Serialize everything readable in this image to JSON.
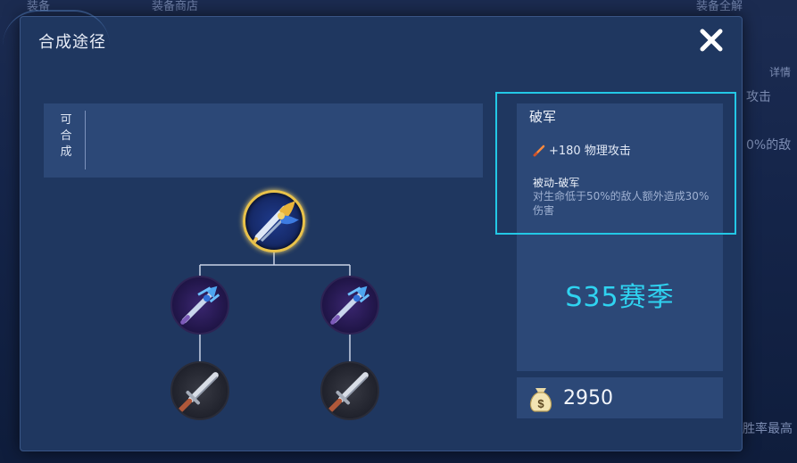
{
  "background": {
    "tab_left": "装备",
    "tab_mid": "装备商店",
    "tab_right": "装备全解",
    "detail": "详情",
    "frag_attack": "攻击",
    "frag_enemy": "0%的敌",
    "frag_bottom": "胜率最高"
  },
  "dialog": {
    "title": "合成途径",
    "close_icon": "close-icon"
  },
  "craftable": {
    "label_chars": [
      "可",
      "合",
      "成"
    ]
  },
  "tree": {
    "root": {
      "name": "破军",
      "icon": "broken-army-blade-icon"
    },
    "mid": [
      {
        "icon": "blue-trident-icon"
      },
      {
        "icon": "blue-trident-icon"
      }
    ],
    "leaf": [
      {
        "icon": "iron-sword-icon"
      },
      {
        "icon": "iron-sword-icon"
      }
    ]
  },
  "item": {
    "name": "破军",
    "stat_icon": "sword-icon",
    "stat": "+180 物理攻击",
    "passive_name": "被动-破军",
    "passive_desc": "对生命低于50%的敌人额外造成30%伤害",
    "season": "S35赛季",
    "price_icon": "gold-bag-icon",
    "price": "2950"
  },
  "colors": {
    "highlight": "#23c8e6",
    "season": "#2fd3f0",
    "root_ring": "#e9c24a"
  }
}
